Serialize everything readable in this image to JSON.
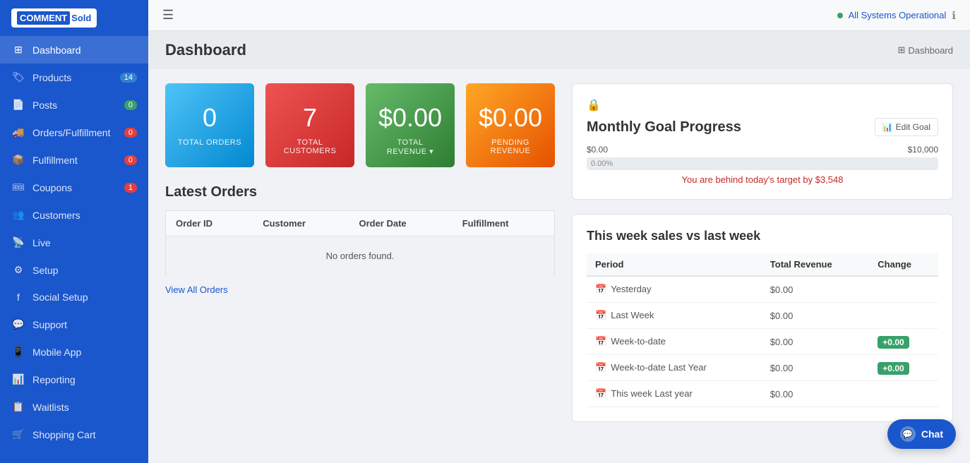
{
  "app": {
    "name": "COMMENT Sold",
    "logo_comment": "COMMENT",
    "logo_sold": "Sold"
  },
  "topbar": {
    "status_label": "All Systems Operational"
  },
  "page": {
    "title": "Dashboard",
    "breadcrumb": "Dashboard"
  },
  "stat_cards": [
    {
      "value": "0",
      "label": "TOTAL ORDERS",
      "color": "blue"
    },
    {
      "value": "7",
      "label": "TOTAL CUSTOMERS",
      "color": "red"
    },
    {
      "value": "$0.00",
      "label": "TOTAL REVENUE",
      "color": "green",
      "has_arrow": true
    },
    {
      "value": "$0.00",
      "label": "PENDING REVENUE",
      "color": "orange"
    }
  ],
  "latest_orders": {
    "title": "Latest Orders",
    "columns": [
      "Order ID",
      "Customer",
      "Order Date",
      "Fulfillment"
    ],
    "empty_message": "No orders found.",
    "view_all_label": "View All Orders"
  },
  "monthly_goal": {
    "title": "Monthly Goal Progress",
    "edit_btn": "Edit Goal",
    "range_start": "$0.00",
    "range_end": "$10,000",
    "progress_pct": "0.00%",
    "behind_message": "You are behind today's target by $3,548"
  },
  "weekly_sales": {
    "title": "This week sales vs last week",
    "columns": [
      "Period",
      "Total Revenue",
      "Change"
    ],
    "rows": [
      {
        "period": "Yesterday",
        "revenue": "$0.00",
        "change": null
      },
      {
        "period": "Last Week",
        "revenue": "$0.00",
        "change": null
      },
      {
        "period": "Week-to-date",
        "revenue": "$0.00",
        "change": "+0.00"
      },
      {
        "period": "Week-to-date Last Year",
        "revenue": "$0.00",
        "change": "+0.00"
      },
      {
        "period": "This week Last year",
        "revenue": "$0.00",
        "change": null
      }
    ]
  },
  "nav": {
    "items": [
      {
        "label": "Dashboard",
        "icon": "⊞",
        "active": true,
        "badge": null
      },
      {
        "label": "Products",
        "icon": "🏷",
        "active": false,
        "badge": "14",
        "badge_color": "blue"
      },
      {
        "label": "Posts",
        "icon": "📄",
        "active": false,
        "badge": "0",
        "badge_color": "green"
      },
      {
        "label": "Orders/Fulfillment",
        "icon": "🚚",
        "active": false,
        "badge": "0",
        "badge_color": "red"
      },
      {
        "label": "Fulfillment",
        "icon": "📦",
        "active": false,
        "badge": "0",
        "badge_color": "red"
      },
      {
        "label": "Coupons",
        "icon": "🎟",
        "active": false,
        "badge": "1",
        "badge_color": "red"
      },
      {
        "label": "Customers",
        "icon": "👥",
        "active": false,
        "badge": null
      },
      {
        "label": "Live",
        "icon": "📡",
        "active": false,
        "badge": null
      },
      {
        "label": "Setup",
        "icon": "⚙",
        "active": false,
        "badge": null
      },
      {
        "label": "Social Setup",
        "icon": "f",
        "active": false,
        "badge": null
      },
      {
        "label": "Support",
        "icon": "💬",
        "active": false,
        "badge": null
      },
      {
        "label": "Mobile App",
        "icon": "📱",
        "active": false,
        "badge": null
      },
      {
        "label": "Reporting",
        "icon": "📊",
        "active": false,
        "badge": null
      },
      {
        "label": "Waitlists",
        "icon": "📋",
        "active": false,
        "badge": null
      },
      {
        "label": "Shopping Cart",
        "icon": "🛒",
        "active": false,
        "badge": null
      }
    ]
  },
  "chat": {
    "label": "Chat"
  }
}
